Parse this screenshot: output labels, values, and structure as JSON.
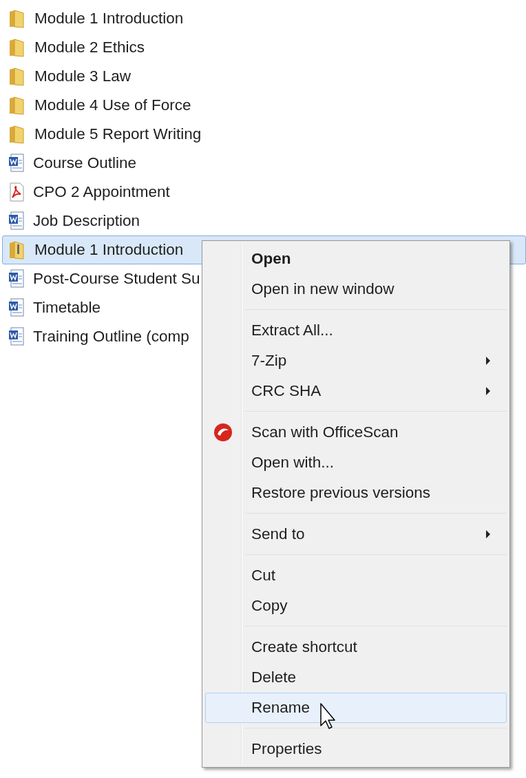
{
  "files": [
    {
      "name": "Module 1 Introduction",
      "kind": "folder",
      "selected": false
    },
    {
      "name": "Module 2 Ethics",
      "kind": "folder",
      "selected": false
    },
    {
      "name": "Module 3 Law",
      "kind": "folder",
      "selected": false
    },
    {
      "name": "Module 4 Use of Force",
      "kind": "folder",
      "selected": false
    },
    {
      "name": "Module 5 Report Writing",
      "kind": "folder",
      "selected": false
    },
    {
      "name": "Course Outline",
      "kind": "word",
      "selected": false
    },
    {
      "name": "CPO 2 Appointment",
      "kind": "pdf",
      "selected": false
    },
    {
      "name": "Job Description",
      "kind": "word",
      "selected": false
    },
    {
      "name": "Module 1 Introduction",
      "kind": "zip",
      "selected": true
    },
    {
      "name": "Post-Course Student Su",
      "kind": "word",
      "selected": false
    },
    {
      "name": "Timetable",
      "kind": "word",
      "selected": false
    },
    {
      "name": "Training Outline (comp",
      "kind": "word",
      "selected": false
    }
  ],
  "context_menu": {
    "groups": [
      [
        {
          "label": "Open",
          "default": true,
          "submenu": false,
          "has_icon": false,
          "selected": false
        },
        {
          "label": "Open in new window",
          "default": false,
          "submenu": false,
          "has_icon": false,
          "selected": false
        }
      ],
      [
        {
          "label": "Extract All...",
          "default": false,
          "submenu": false,
          "has_icon": false,
          "selected": false
        },
        {
          "label": "7-Zip",
          "default": false,
          "submenu": true,
          "has_icon": false,
          "selected": false
        },
        {
          "label": "CRC SHA",
          "default": false,
          "submenu": true,
          "has_icon": false,
          "selected": false
        }
      ],
      [
        {
          "label": "Scan with OfficeScan",
          "default": false,
          "submenu": false,
          "has_icon": true,
          "selected": false
        },
        {
          "label": "Open with...",
          "default": false,
          "submenu": false,
          "has_icon": false,
          "selected": false
        },
        {
          "label": "Restore previous versions",
          "default": false,
          "submenu": false,
          "has_icon": false,
          "selected": false
        }
      ],
      [
        {
          "label": "Send to",
          "default": false,
          "submenu": true,
          "has_icon": false,
          "selected": false
        }
      ],
      [
        {
          "label": "Cut",
          "default": false,
          "submenu": false,
          "has_icon": false,
          "selected": false
        },
        {
          "label": "Copy",
          "default": false,
          "submenu": false,
          "has_icon": false,
          "selected": false
        }
      ],
      [
        {
          "label": "Create shortcut",
          "default": false,
          "submenu": false,
          "has_icon": false,
          "selected": false
        },
        {
          "label": "Delete",
          "default": false,
          "submenu": false,
          "has_icon": false,
          "selected": false
        },
        {
          "label": "Rename",
          "default": false,
          "submenu": false,
          "has_icon": false,
          "selected": true
        }
      ],
      [
        {
          "label": "Properties",
          "default": false,
          "submenu": false,
          "has_icon": false,
          "selected": false
        }
      ]
    ]
  }
}
